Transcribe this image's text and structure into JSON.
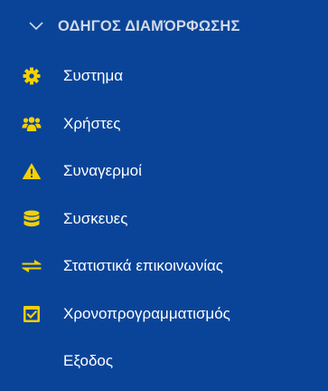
{
  "menu": {
    "header": {
      "label": "ΟΔΗΓΟΣ ΔΙΑΜΌΡΦΩΣΗΣ",
      "icon": "chevron-down-icon"
    },
    "items": [
      {
        "label": "Συστημα",
        "icon": "gear-icon"
      },
      {
        "label": "Χρήστες",
        "icon": "users-icon"
      },
      {
        "label": "Συναγερμοί",
        "icon": "warning-icon"
      },
      {
        "label": "Συσκευες",
        "icon": "database-icon"
      },
      {
        "label": "Στατιστικά επικοινωνίας",
        "icon": "transfer-icon"
      },
      {
        "label": "Χρονοπρογραμματισμός",
        "icon": "calendar-check-icon"
      },
      {
        "label": "Εξοδος",
        "icon": ""
      }
    ]
  },
  "colors": {
    "background": "#0a4499",
    "header_text": "#d2d9e6",
    "item_text": "#ffffff",
    "icon_accent": "#f5d000"
  }
}
